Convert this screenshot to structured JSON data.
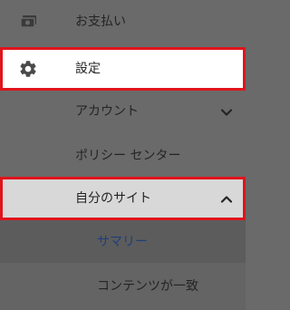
{
  "nav": {
    "items": [
      {
        "label": "お支払い",
        "icon": "payments-icon"
      },
      {
        "label": "設定",
        "icon": "gear-icon",
        "highlighted": true
      },
      {
        "label": "アカウント",
        "icon": "chevron-down-icon"
      },
      {
        "label": "ポリシー センター"
      },
      {
        "label": "自分のサイト",
        "icon": "chevron-up-icon",
        "expanded": true,
        "highlighted": true
      }
    ],
    "sub_items": [
      {
        "label": "サマリー",
        "active": true
      },
      {
        "label": "コンテンツが一致"
      }
    ]
  },
  "colors": {
    "background": "#6a6a6a",
    "highlight_border": "#e0141c",
    "selected_bg": "#ffffff",
    "expanded_bg": "#d8d8d8",
    "active_sub_text": "#1f3f7a",
    "text": "#242424"
  }
}
